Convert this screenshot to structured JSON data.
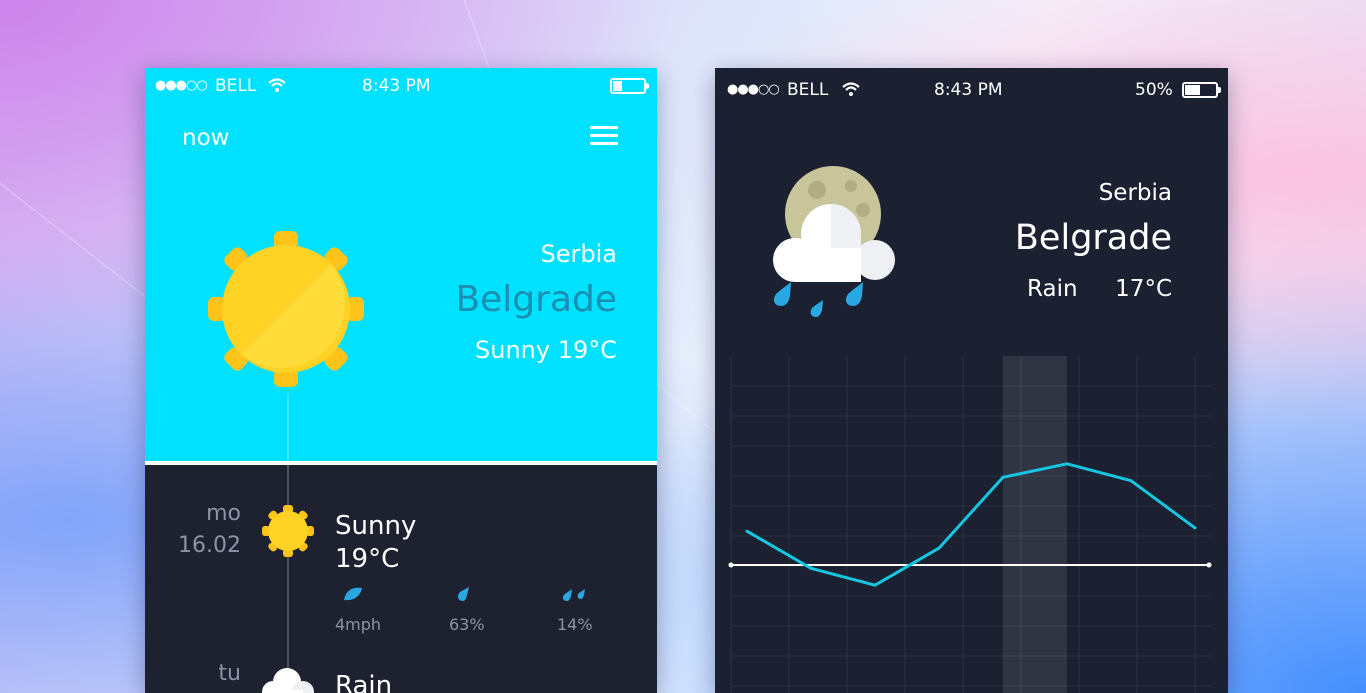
{
  "left_phone": {
    "status": {
      "carrier": "BELL",
      "time": "8:43 PM",
      "signal_icon": "signal-dots-icon",
      "wifi_icon": "wifi-icon",
      "battery_level": 0.3
    },
    "header": {
      "title": "now",
      "menu_icon": "hamburger-menu-icon"
    },
    "current": {
      "country": "Serbia",
      "city": "Belgrade",
      "condition": "Sunny 19°C",
      "icon": "sun-icon"
    },
    "forecast": [
      {
        "day": "mo",
        "date": "16.02",
        "condition": "Sunny",
        "temp": "19°C",
        "icon": "sun-icon",
        "stats": [
          {
            "icon": "leaf-wind-icon",
            "value": "4mph"
          },
          {
            "icon": "drop-icon",
            "value": "63%"
          },
          {
            "icon": "rain-drops-icon",
            "value": "14%"
          }
        ]
      },
      {
        "day": "tu",
        "condition": "Rain",
        "icon": "cloud-icon"
      }
    ]
  },
  "right_phone": {
    "status": {
      "carrier": "BELL",
      "time": "8:43 PM",
      "battery_text": "50%",
      "signal_icon": "signal-dots-icon",
      "wifi_icon": "wifi-icon",
      "battery_level": 0.5
    },
    "current": {
      "country": "Serbia",
      "city": "Belgrade",
      "condition": "Rain",
      "temp": "17°C",
      "icon": "moon-cloud-rain-icon"
    },
    "chart": {
      "type": "line",
      "values": [
        0.48,
        0.37,
        0.32,
        0.43,
        0.64,
        0.68,
        0.63,
        0.49
      ],
      "baseline": 0.38,
      "highlight_index": 4.5,
      "line_color": "#16c6e0",
      "baseline_color": "#ffffff",
      "grid": true
    }
  },
  "colors": {
    "accent": "#00e1ff",
    "sun": "#ffd224",
    "dark": "#1e2230",
    "muted_text": "#8d93a4",
    "rain": "#29a7e2"
  }
}
